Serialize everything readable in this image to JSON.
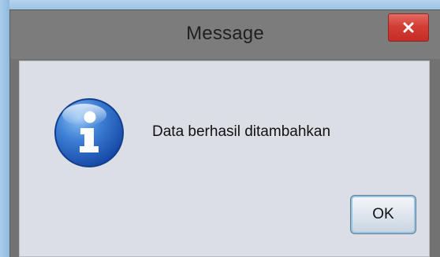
{
  "dialog": {
    "title": "Message",
    "message": "Data berhasil ditambahkan",
    "ok_label": "OK",
    "icon": "info-icon",
    "close_icon": "close-icon"
  },
  "colors": {
    "desktop": "#9fc6e8",
    "title_bar": "#7c7c7c",
    "content_background": "#dcdee6",
    "close_button": "#d23e36",
    "info_icon": "#1f5fb8"
  }
}
